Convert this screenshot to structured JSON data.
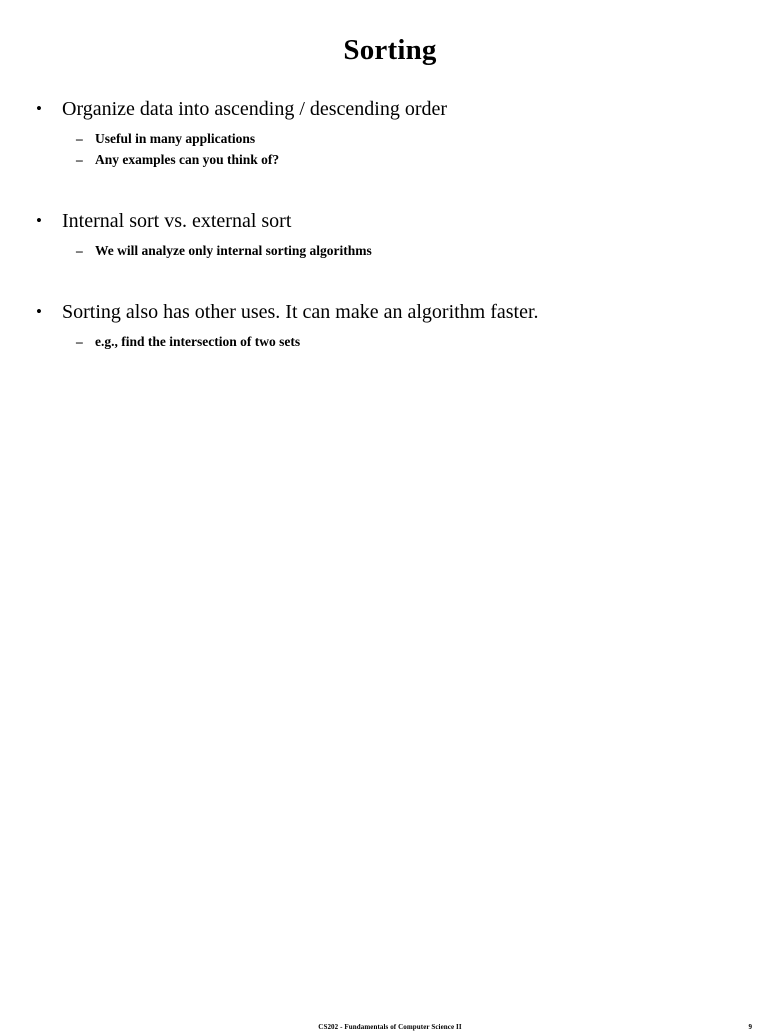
{
  "slide": {
    "title": "Sorting",
    "bullet_marker": "•",
    "sub_bullet_marker": "–",
    "groups": [
      {
        "main": "Organize data into ascending / descending order",
        "subs": [
          "Useful in many applications",
          "Any examples can you think of?"
        ]
      },
      {
        "main": "Internal sort vs. external sort",
        "subs": [
          "We will analyze only internal sorting algorithms"
        ]
      },
      {
        "main": "Sorting also has other uses. It can make an algorithm faster.",
        "subs": [
          "e.g., find the intersection of two sets"
        ]
      }
    ],
    "footer": {
      "course_text": "CS202 - Fundamentals of Computer Science II",
      "page_number": "9"
    }
  }
}
